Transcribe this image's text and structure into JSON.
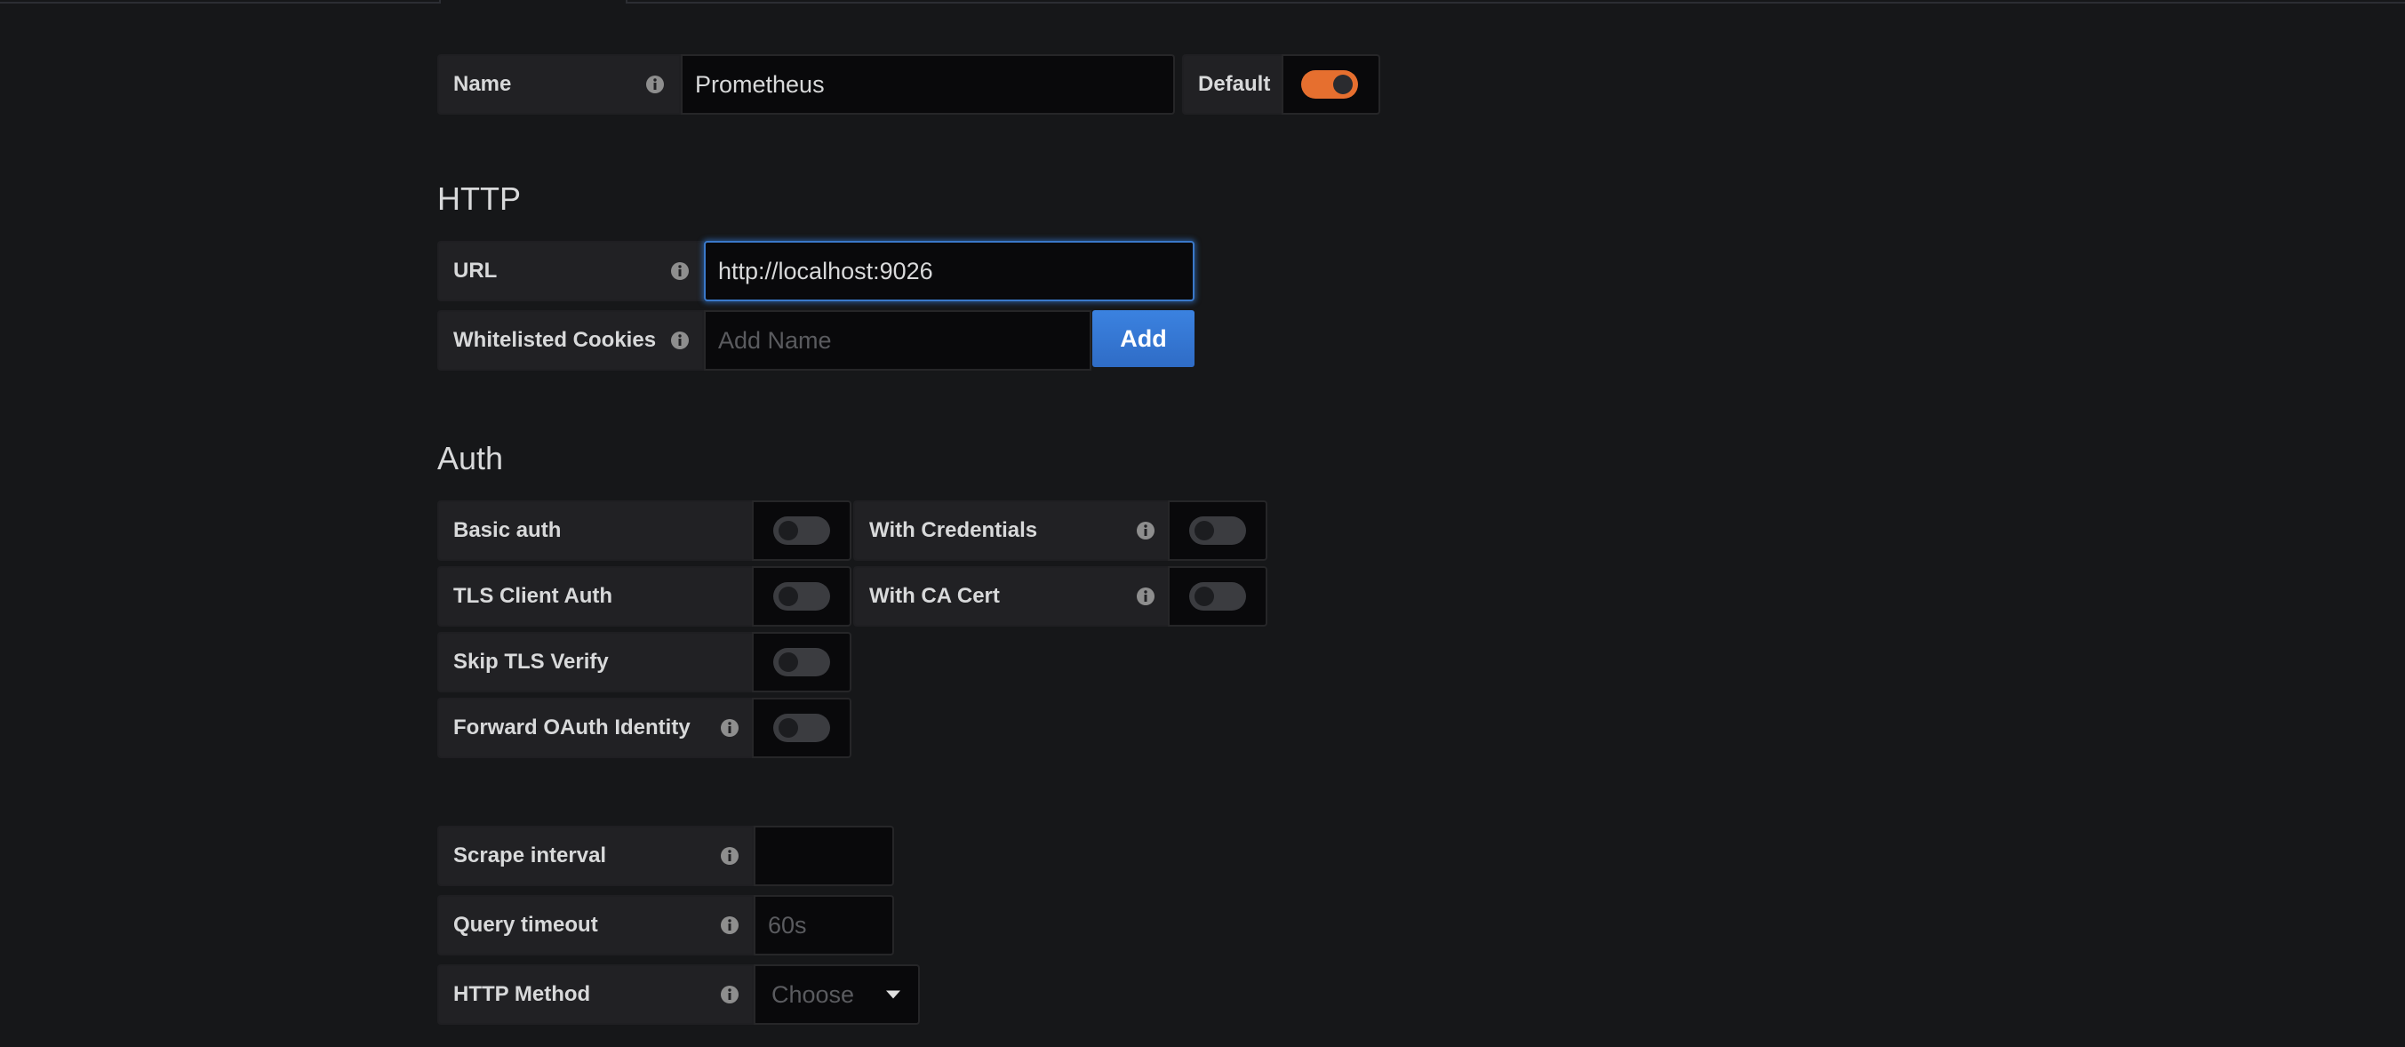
{
  "general": {
    "name_label": "Name",
    "name_value": "Prometheus",
    "default_label": "Default",
    "default_on": true
  },
  "http": {
    "title": "HTTP",
    "url_label": "URL",
    "url_value": "http://localhost:9026",
    "cookies_label": "Whitelisted Cookies",
    "cookies_placeholder": "Add Name",
    "add_label": "Add"
  },
  "auth": {
    "title": "Auth",
    "basic_auth_label": "Basic auth",
    "with_credentials_label": "With Credentials",
    "tls_client_auth_label": "TLS Client Auth",
    "with_ca_cert_label": "With CA Cert",
    "skip_tls_verify_label": "Skip TLS Verify",
    "forward_oauth_label": "Forward OAuth Identity"
  },
  "prometheus": {
    "scrape_interval_label": "Scrape interval",
    "scrape_interval_value": "",
    "query_timeout_label": "Query timeout",
    "query_timeout_placeholder": "60s",
    "http_method_label": "HTTP Method",
    "http_method_placeholder": "Choose"
  },
  "colors": {
    "accent_orange": "#e66f2f",
    "primary_blue": "#3274d9",
    "background": "#161719"
  },
  "icons": {
    "info": "info-icon",
    "caret": "caret-down-icon"
  }
}
